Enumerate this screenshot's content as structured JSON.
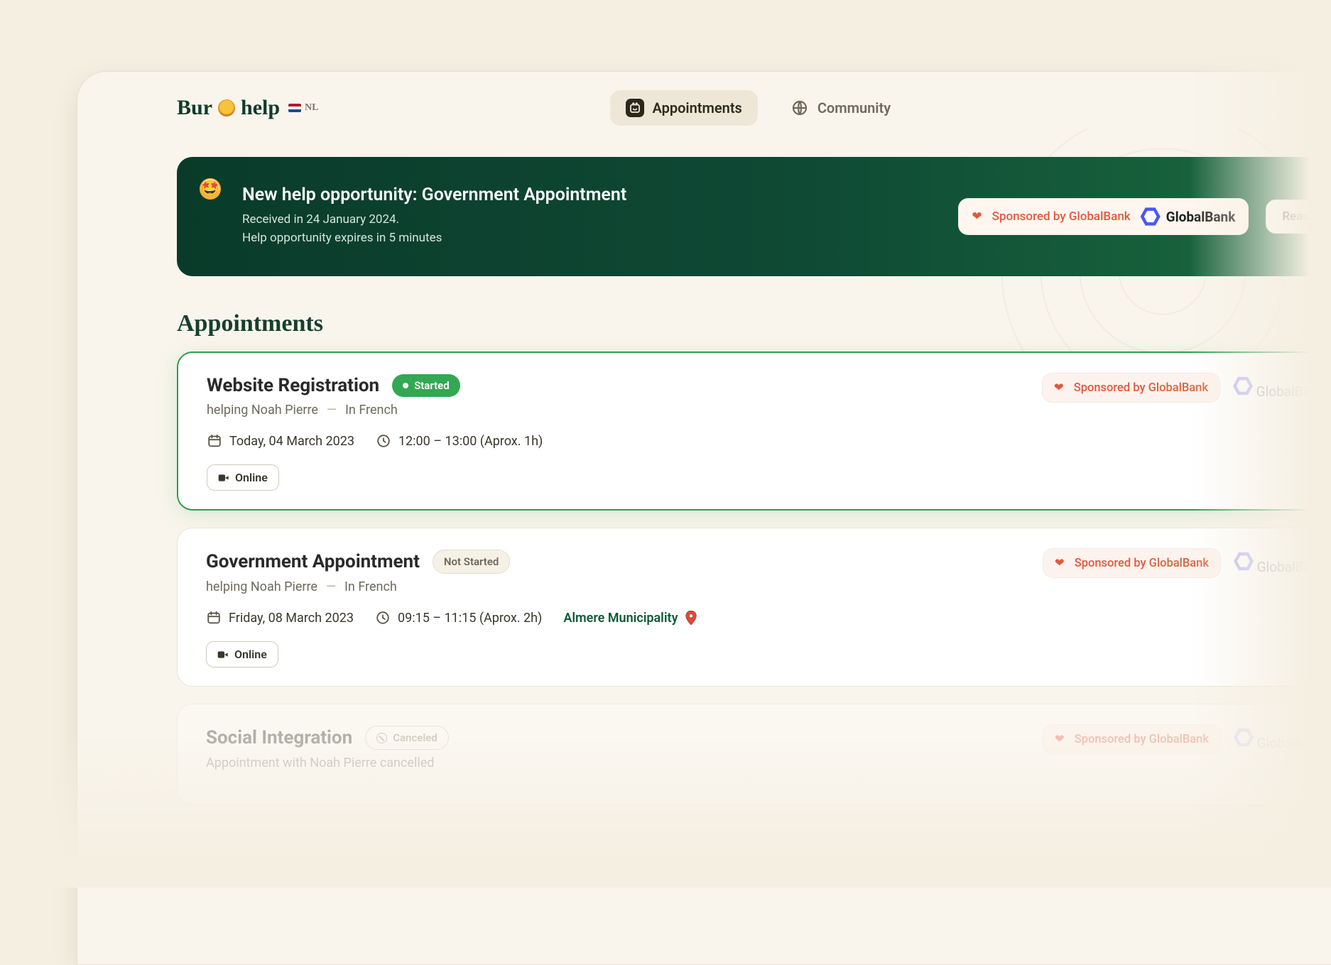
{
  "brand": {
    "pre": "Bur",
    "post": "help"
  },
  "locale": {
    "code": "NL"
  },
  "nav": {
    "appointments": "Appointments",
    "community": "Community"
  },
  "banner": {
    "title": "New help opportunity: Government Appointment",
    "received": "Received in 24 January 2024.",
    "expires": "Help opportunity expires in 5 minutes",
    "sponsor_prefix": "Sponsored by ",
    "sponsor_name": "GlobalBank",
    "sponsor_logo_text": "GlobalBank",
    "action": "Read"
  },
  "section": {
    "title": "Appointments"
  },
  "cards": [
    {
      "title": "Website Registration",
      "status": "started",
      "status_label": "Started",
      "sub_lead": "helping Noah Pierre",
      "sub_lang": "In French",
      "date": "Today, 04 March 2023",
      "time": "12:00 – 13:00 (Aprox. 1h)",
      "location": "",
      "tag": "Online",
      "sponsor_prefix": "Sponsored by ",
      "sponsor_name": "GlobalBank",
      "logo_text": "GlobalBank"
    },
    {
      "title": "Government Appointment",
      "status": "notstarted",
      "status_label": "Not Started",
      "sub_lead": "helping Noah Pierre",
      "sub_lang": "In French",
      "date": "Friday, 08 March 2023",
      "time": "09:15 – 11:15 (Aprox. 2h)",
      "location": "Almere Municipality",
      "tag": "Online",
      "sponsor_prefix": "Sponsored by ",
      "sponsor_name": "GlobalBank",
      "logo_text": "GlobalBank"
    },
    {
      "title": "Social Integration",
      "status": "canceled",
      "status_label": "Canceled",
      "sub_lead": "Appointment with Noah Pierre cancelled",
      "sub_lang": "",
      "date": "",
      "time": "",
      "location": "",
      "tag": "",
      "sponsor_prefix": "Sponsored by ",
      "sponsor_name": "GlobalBank",
      "logo_text": "GlobalBank"
    }
  ]
}
